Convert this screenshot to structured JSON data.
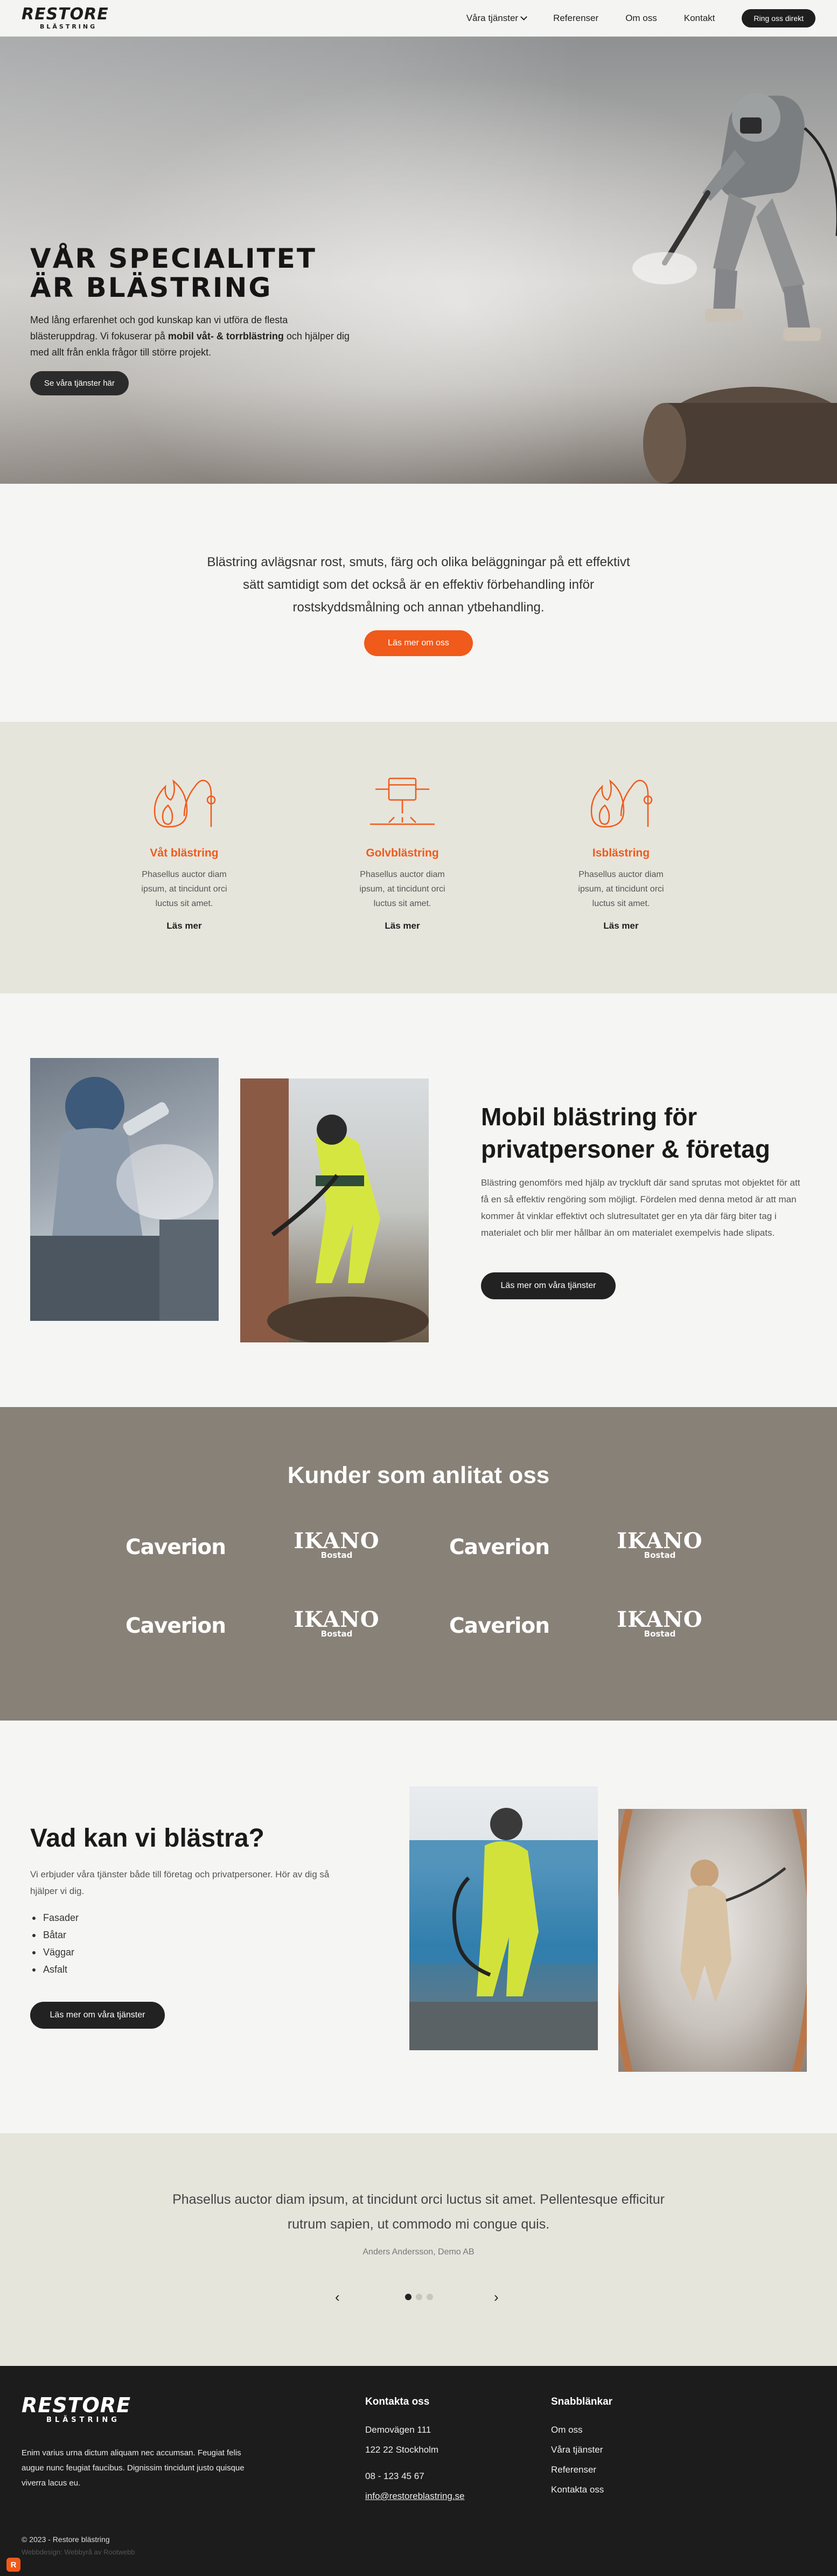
{
  "header": {
    "logo_main": "RESTORE",
    "logo_sub": "BLÄSTRING",
    "nav": [
      "Våra tjänster",
      "Referenser",
      "Om oss",
      "Kontakt"
    ],
    "cta": "Ring oss direkt"
  },
  "hero": {
    "title_line1": "Vår specialitet",
    "title_line2": "är blästring",
    "text_part1": "Med lång erfarenhet och god kunskap kan vi utföra de flesta blästeruppdrag. Vi fokuserar på ",
    "text_bold": "mobil våt- & torrblästring",
    "text_part2": " och hjälper dig med allt från enkla frågor till större projekt.",
    "button": "Se våra tjänster här"
  },
  "intro": {
    "text": "Blästring avlägsnar rost, smuts, färg och olika beläggningar på ett effektivt sätt samtidigt som det också är en effektiv förbehandling inför rostskyddsmålning och annan ytbehandling.",
    "button": "Läs mer om oss"
  },
  "services": [
    {
      "title": "Våt blästring",
      "text": "Phasellus auctor diam ipsum, at tincidunt orci luctus sit amet.",
      "link": "Läs mer",
      "icon": "flame-hose-icon"
    },
    {
      "title": "Golvblästring",
      "text": "Phasellus auctor diam ipsum, at tincidunt orci luctus sit amet.",
      "link": "Läs mer",
      "icon": "floor-blaster-icon"
    },
    {
      "title": "Isblästring",
      "text": "Phasellus auctor diam ipsum, at tincidunt orci luctus sit amet.",
      "link": "Läs mer",
      "icon": "flame-hose-icon"
    }
  ],
  "mobile": {
    "title": "Mobil blästring för privatpersoner & företag",
    "text": "Blästring genomförs med hjälp av tryckluft där sand sprutas mot objektet för att få en så effektiv rengöring som möjligt. Fördelen med denna metod är att man kommer åt vinklar effektivt och slutresultatet ger en yta där färg biter tag i materialet och blir mer hållbar än om materialet exempelvis hade slipats.",
    "button": "Läs mer om våra tjänster"
  },
  "clients": {
    "title": "Kunder som anlitat oss",
    "logos": [
      {
        "name": "Caverion"
      },
      {
        "name": "IKANO",
        "sub": "Bostad"
      },
      {
        "name": "Caverion"
      },
      {
        "name": "IKANO",
        "sub": "Bostad"
      },
      {
        "name": "Caverion"
      },
      {
        "name": "IKANO",
        "sub": "Bostad"
      },
      {
        "name": "Caverion"
      },
      {
        "name": "IKANO",
        "sub": "Bostad"
      }
    ]
  },
  "what": {
    "title": "Vad kan vi blästra?",
    "text": "Vi erbjuder våra tjänster både till företag och privatpersoner. Hör av dig så hjälper vi dig.",
    "items": [
      "Fasader",
      "Båtar",
      "Väggar",
      "Asfalt"
    ],
    "button": "Läs mer om våra tjänster"
  },
  "testimonial": {
    "quote": "Phasellus auctor diam ipsum, at tincidunt orci luctus sit amet. Pellentesque efficitur rutrum sapien, ut commodo mi congue quis.",
    "author": "Anders Andersson, Demo AB",
    "prev": "‹",
    "next": "›"
  },
  "footer": {
    "logo_main": "RESTORE",
    "logo_sub": "BLÄSTRING",
    "text": "Enim varius urna dictum aliquam nec accumsan. Feugiat felis augue nunc feugiat faucibus. Dignissim tincidunt justo quisque viverra lacus eu.",
    "contact_heading": "Kontakta oss",
    "address1": "Demovägen 111",
    "address2": "122 22 Stockholm",
    "phone": "08 - 123 45 67",
    "email": "info@restoreblastring.se",
    "links_heading": "Snabblänkar",
    "links": [
      "Om oss",
      "Våra tjänster",
      "Referenser",
      "Kontakta oss"
    ],
    "copyright": "© 2023 - Restore blästring",
    "credit": "Webbdesign: Webbyrå av Rootwebb",
    "badge": "R"
  },
  "colors": {
    "accent": "#f05a1a",
    "dark": "#1e1e1e",
    "beige": "#e6e5dc",
    "clients_bg": "#888178"
  }
}
